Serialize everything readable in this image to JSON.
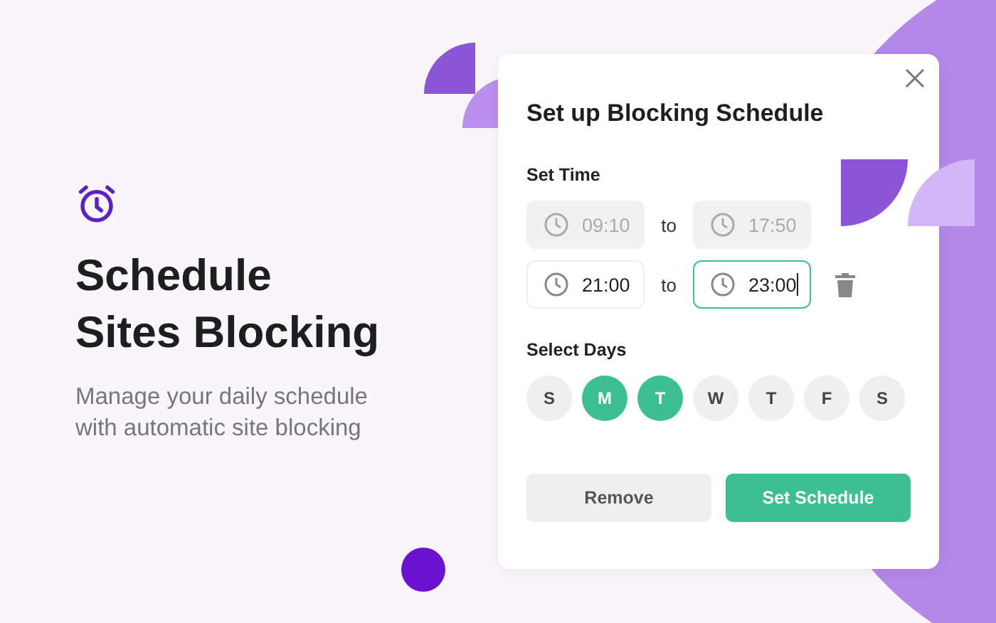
{
  "hero": {
    "title_lines": [
      "Schedule",
      "Sites Blocking"
    ],
    "subtitle_lines": [
      "Manage your daily schedule",
      "with automatic site blocking"
    ]
  },
  "dialog": {
    "title": "Set up Blocking Schedule",
    "time_section": {
      "label": "Set Time",
      "rows": [
        {
          "disabled": true,
          "from": {
            "value": "09:10",
            "focused": false
          },
          "separator": "to",
          "to": {
            "value": "17:50",
            "focused": false
          }
        },
        {
          "disabled": false,
          "from": {
            "value": "21:00",
            "focused": false
          },
          "separator": "to",
          "to": {
            "value": "23:00",
            "focused": true
          }
        }
      ]
    },
    "days_section": {
      "label": "Select Days",
      "days": [
        {
          "label": "S",
          "selected": false
        },
        {
          "label": "M",
          "selected": true
        },
        {
          "label": "T",
          "selected": true
        },
        {
          "label": "W",
          "selected": false
        },
        {
          "label": "T",
          "selected": false
        },
        {
          "label": "F",
          "selected": false
        },
        {
          "label": "S",
          "selected": false
        }
      ]
    },
    "buttons": [
      {
        "label": "Remove",
        "kind": "secondary"
      },
      {
        "label": "Set Schedule",
        "kind": "primary"
      }
    ]
  }
}
